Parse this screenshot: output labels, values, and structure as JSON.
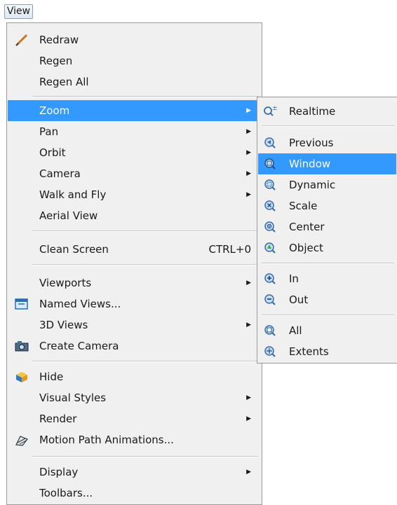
{
  "menubar": {
    "view_label": "View"
  },
  "menu": {
    "items": [
      {
        "label": "Redraw",
        "icon": "pencil-icon"
      },
      {
        "label": "Regen"
      },
      {
        "label": "Regen All"
      },
      {
        "label": "Zoom",
        "submenu": true,
        "selected": true
      },
      {
        "label": "Pan",
        "submenu": true
      },
      {
        "label": "Orbit",
        "submenu": true
      },
      {
        "label": "Camera",
        "submenu": true
      },
      {
        "label": "Walk and Fly",
        "submenu": true
      },
      {
        "label": "Aerial View"
      },
      {
        "label": "Clean Screen",
        "shortcut": "CTRL+0"
      },
      {
        "label": "Viewports",
        "submenu": true
      },
      {
        "label": "Named Views...",
        "icon": "named-views-icon"
      },
      {
        "label": "3D Views",
        "submenu": true
      },
      {
        "label": "Create Camera",
        "icon": "camera-icon"
      },
      {
        "label": "Hide",
        "icon": "hide-icon"
      },
      {
        "label": "Visual Styles",
        "submenu": true
      },
      {
        "label": "Render",
        "submenu": true
      },
      {
        "label": "Motion Path Animations...",
        "icon": "motion-path-icon"
      },
      {
        "label": "Display",
        "submenu": true
      },
      {
        "label": "Toolbars..."
      }
    ]
  },
  "zoom_submenu": {
    "items": [
      {
        "label": "Realtime",
        "icon": "zoom-realtime-icon"
      },
      {
        "label": "Previous",
        "icon": "zoom-previous-icon"
      },
      {
        "label": "Window",
        "icon": "zoom-window-icon",
        "selected": true
      },
      {
        "label": "Dynamic",
        "icon": "zoom-dynamic-icon"
      },
      {
        "label": "Scale",
        "icon": "zoom-scale-icon"
      },
      {
        "label": "Center",
        "icon": "zoom-center-icon"
      },
      {
        "label": "Object",
        "icon": "zoom-object-icon"
      },
      {
        "label": "In",
        "icon": "zoom-in-icon"
      },
      {
        "label": "Out",
        "icon": "zoom-out-icon"
      },
      {
        "label": "All",
        "icon": "zoom-all-icon"
      },
      {
        "label": "Extents",
        "icon": "zoom-extents-icon"
      }
    ]
  },
  "colors": {
    "highlight": "#3399ff",
    "menu_bg": "#f0f0f0"
  }
}
